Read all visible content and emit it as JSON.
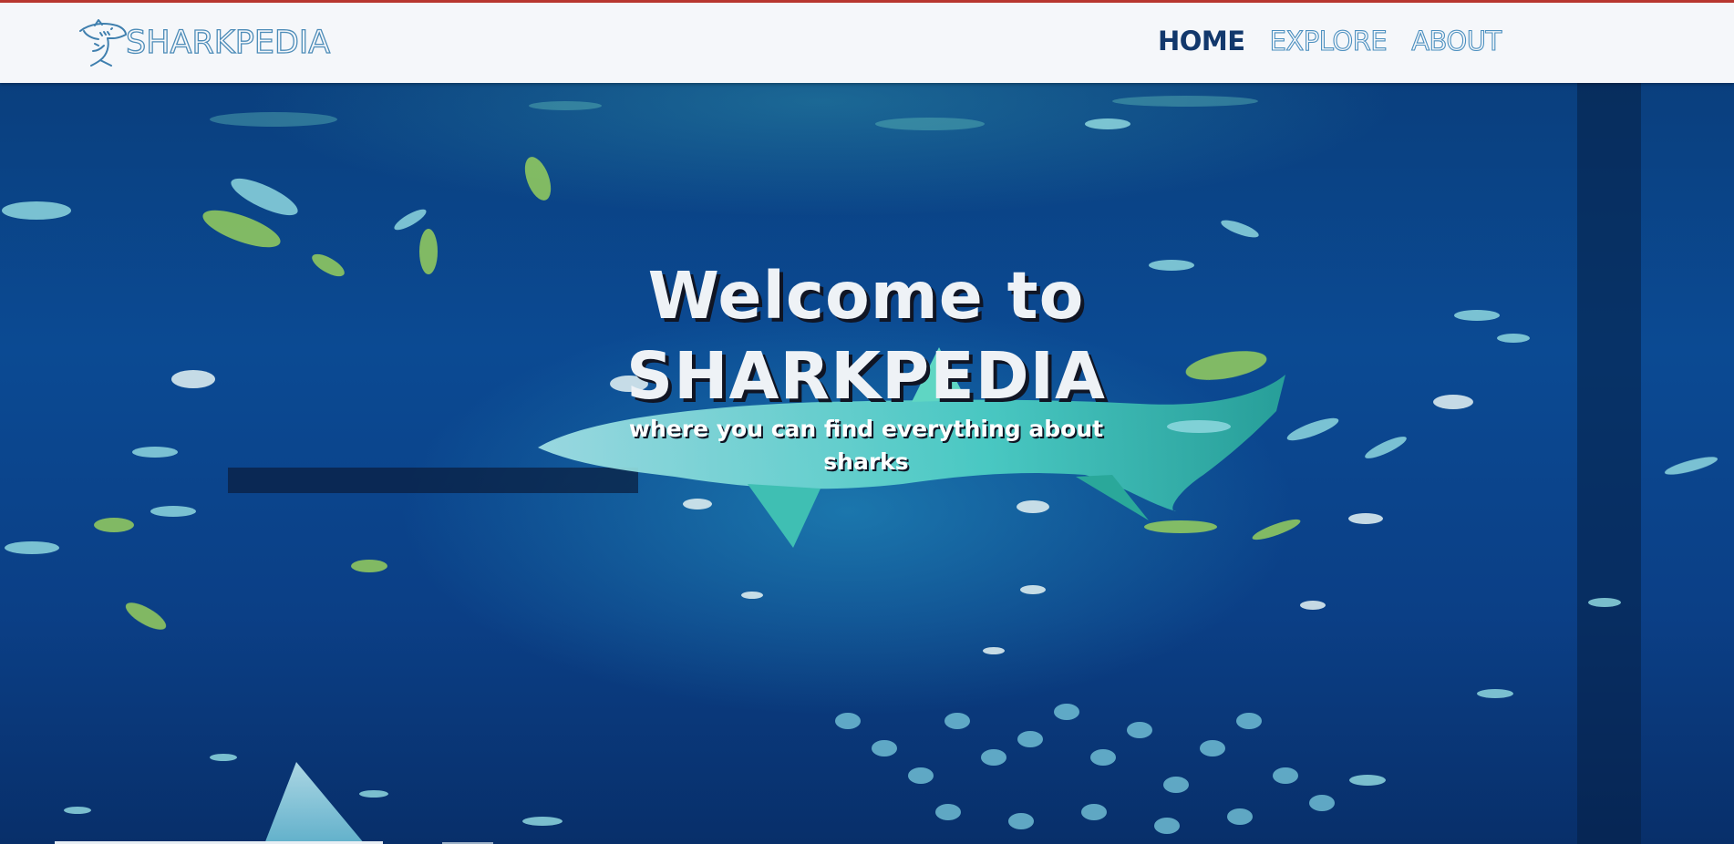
{
  "brand": {
    "name": "SHARKPEDIA",
    "icon": "shark-logo-icon"
  },
  "nav": {
    "items": [
      {
        "label": "HOME",
        "active": true
      },
      {
        "label": "EXPLORE",
        "active": false
      },
      {
        "label": "ABOUT",
        "active": false
      }
    ]
  },
  "hero": {
    "title_line1": "Welcome to",
    "title_line2": "SHARKPEDIA",
    "subtitle": "where you can find everything about sharks",
    "background": "underwater-aquarium-shark-image"
  },
  "colors": {
    "accent_top": "#b8372f",
    "nav_active": "#12386c",
    "nav_outline": "#4b8fbf",
    "navbar_bg": "#f5f7fa"
  }
}
